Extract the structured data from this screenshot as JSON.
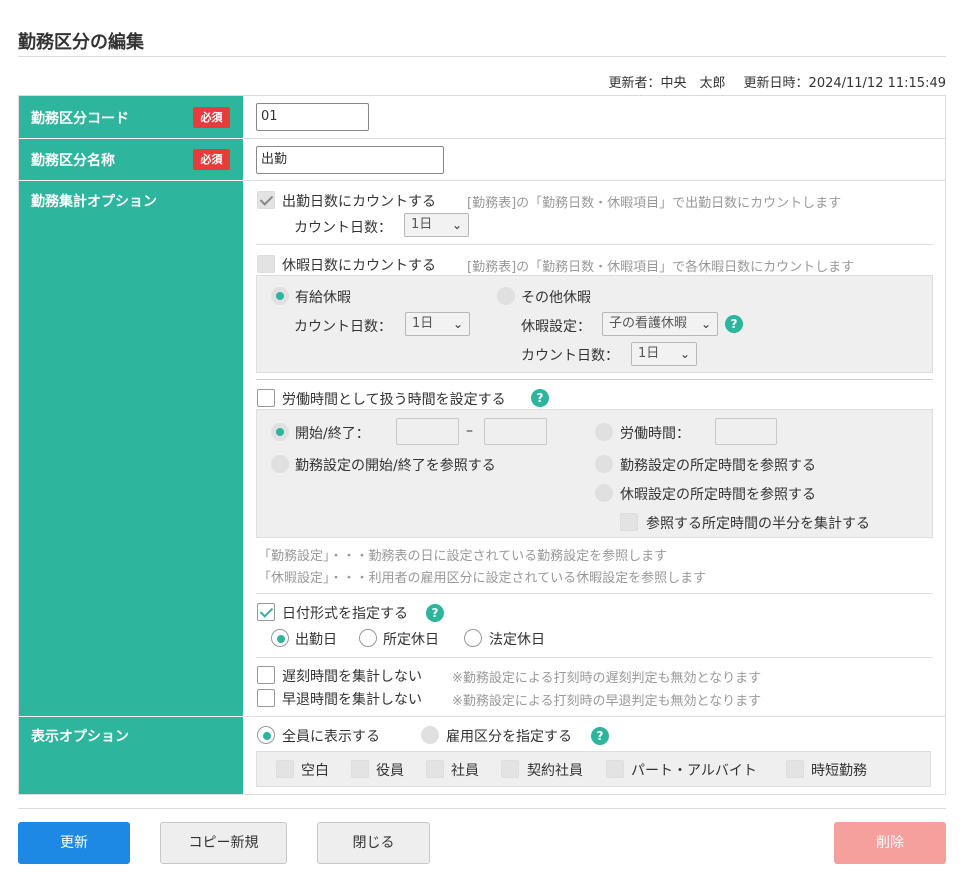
{
  "page": {
    "title": "勤務区分の編集"
  },
  "meta": {
    "updated_by": "更新者：中央　太郎",
    "updated_at": "更新日時：2024/11/12 11:15:49"
  },
  "form": {
    "code": {
      "label": "勤務区分コード",
      "required": "必須",
      "value": "01"
    },
    "name": {
      "label": "勤務区分名称",
      "required": "必須",
      "value": "出勤"
    },
    "options": {
      "label": "勤務集計オプション",
      "count_work": {
        "label": "出勤日数にカウントする",
        "note": "[勤務表]の「勤務日数・休暇項目」で出勤日数にカウントします",
        "count_label": "カウント日数：",
        "count_value": "1日"
      },
      "count_leave": {
        "label": "休暇日数にカウントする",
        "note": "[勤務表]の「勤務日数・休暇項目」で各休暇日数にカウントします",
        "paid": {
          "label": "有給休暇",
          "count_label": "カウント日数：",
          "count_value": "1日"
        },
        "other": {
          "label": "その他休暇",
          "setting_label": "休暇設定：",
          "setting_value": "子の看護休暇",
          "count_label": "カウント日数：",
          "count_value": "1日"
        }
      },
      "work_time": {
        "label": "労働時間として扱う時間を設定する",
        "start_end": "開始/終了：",
        "dash": "–",
        "work_hours": "労働時間：",
        "ref_start_end": "勤務設定の開始/終了を参照する",
        "ref_work_setting": "勤務設定の所定時間を参照する",
        "ref_leave_setting": "休暇設定の所定時間を参照する",
        "half": "参照する所定時間の半分を集計する",
        "note1": "「勤務設定」・・・勤務表の日に設定されている勤務設定を参照します",
        "note2": "「休暇設定」・・・利用者の雇用区分に設定されている休暇設定を参照します"
      },
      "date_format": {
        "label": "日付形式を指定する",
        "opt1": "出勤日",
        "opt2": "所定休日",
        "opt3": "法定休日"
      },
      "late": {
        "label": "遅刻時間を集計しない",
        "note": "※勤務設定による打刻時の遅刻判定も無効となります"
      },
      "early": {
        "label": "早退時間を集計しない",
        "note": "※勤務設定による打刻時の早退判定も無効となります"
      }
    },
    "display": {
      "label": "表示オプション",
      "all": "全員に表示する",
      "specify": "雇用区分を指定する",
      "types": [
        "空白",
        "役員",
        "社員",
        "契約社員",
        "パート・アルバイト",
        "時短勤務"
      ]
    }
  },
  "buttons": {
    "update": "更新",
    "copy": "コピー新規",
    "close": "閉じる",
    "delete": "削除"
  },
  "colors": {
    "accent": "#2db59d",
    "required": "#e83c3c",
    "primary": "#1e88e5",
    "danger": "#f5a09c"
  }
}
